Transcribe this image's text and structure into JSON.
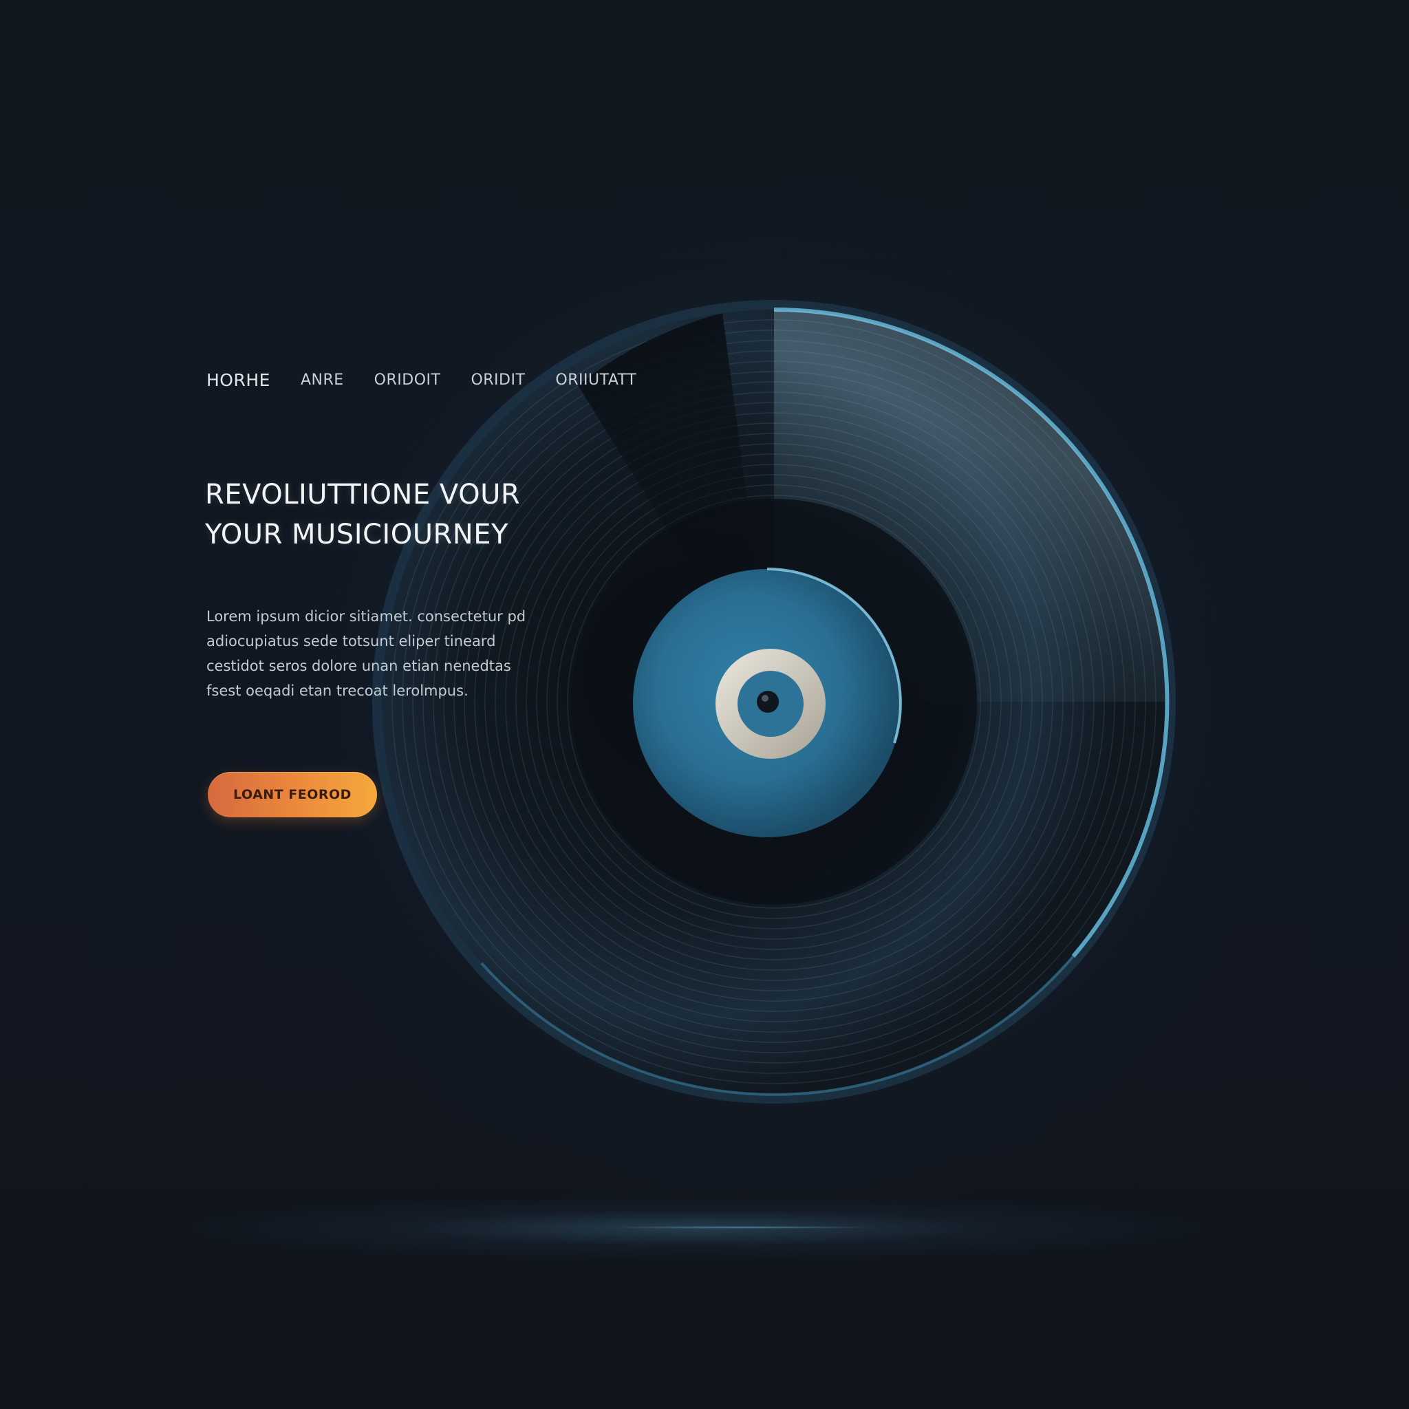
{
  "nav": {
    "items": [
      {
        "label": "HORHE"
      },
      {
        "label": "ANRE"
      },
      {
        "label": "ORIDOIT"
      },
      {
        "label": "ORIDIT"
      },
      {
        "label": "ORIIUTATT"
      }
    ]
  },
  "hero": {
    "title_line1": "REVOLIUTTIONE VOUR",
    "title_line2": "YOUR MUSICIOURNEY",
    "body": "Lorem ipsum dicior sitiamet. consectetur pd adiocupiatus sede totsunt eliper tineard cestidot seros dolore unan etian nenedtas fsest oeqadi etan trecoat lerolmpus.",
    "cta_label": "LOANT FEOROD"
  },
  "colors": {
    "background": "#10151d",
    "accent_orange": "#ee8a3c",
    "accent_blue": "#3b8fb3",
    "record_rim": "#5aa7c6"
  },
  "icons": {
    "record": "vinyl-record-icon"
  }
}
